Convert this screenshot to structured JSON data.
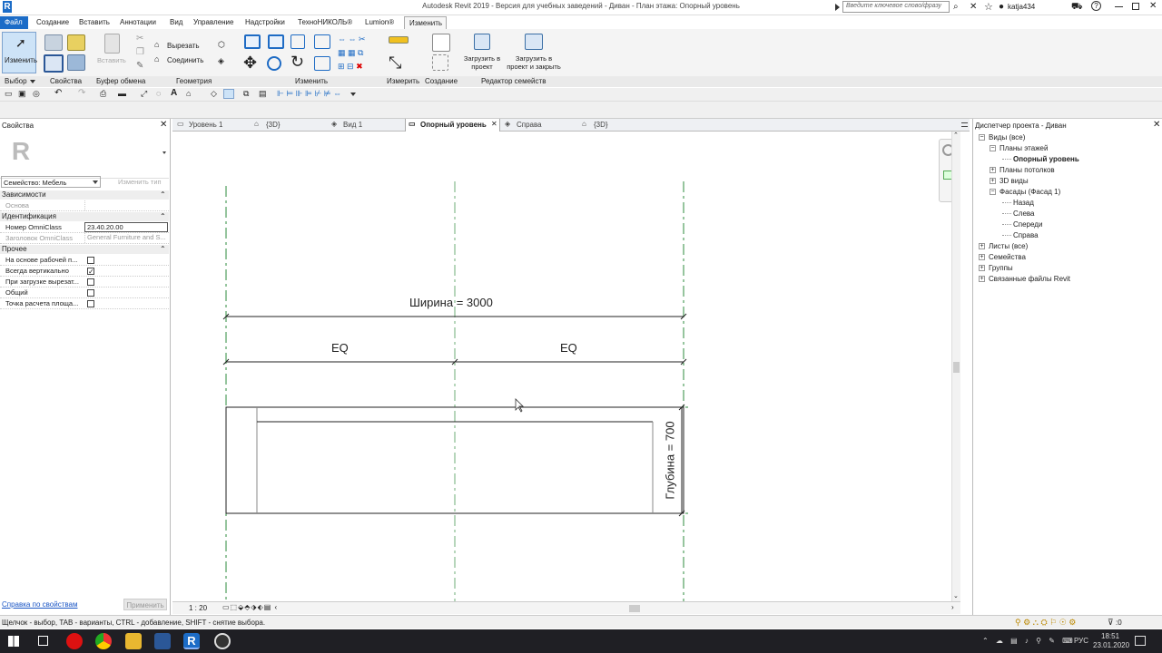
{
  "window": {
    "title": "Autodesk Revit 2019 - Версия для учебных заведений - Диван - План этажа: Опорный уровень"
  },
  "search": {
    "placeholder": "Введите ключевое слово/фразу"
  },
  "user": {
    "name": "katja434"
  },
  "menu": {
    "tabs": [
      "Файл",
      "Создание",
      "Вставить",
      "Аннотации",
      "Вид",
      "Управление",
      "Надстройки",
      "ТехноНИКОЛЬ®",
      "Lumion®",
      "Изменить"
    ],
    "active": "Изменить"
  },
  "ribbon": {
    "modify_label": "Изменить",
    "cut_label": "Вырезать",
    "join_label": "Соединить",
    "paste_label": "Вставить",
    "load_label": "Загрузить в проект",
    "load_close_label": "Загрузить в проект и закрыть",
    "panels": [
      "Выбор",
      "Свойства",
      "Буфер обмена",
      "Геометрия",
      "Изменить",
      "Измерить",
      "Создание",
      "Редактор семейств"
    ]
  },
  "properties": {
    "title": "Свойства",
    "family_selector": "Семейство: Мебель",
    "edit_type_label": "Изменить тип",
    "groups": {
      "constraints": {
        "label": "Зависимости",
        "rows": [
          {
            "key": "Основа",
            "value": ""
          }
        ]
      },
      "identity": {
        "label": "Идентификация",
        "rows": [
          {
            "key": "Номер OmniClass",
            "value": "23.40.20.00"
          },
          {
            "key": "Заголовок OmniClass",
            "value": "General Furniture and S..."
          }
        ]
      },
      "other": {
        "label": "Прочее",
        "rows": [
          {
            "key": "На основе рабочей п...",
            "checked": false
          },
          {
            "key": "Всегда вертикально",
            "checked": true
          },
          {
            "key": "При загрузке вырезат...",
            "checked": false
          },
          {
            "key": "Общий",
            "checked": false
          },
          {
            "key": "Точка расчета площа...",
            "checked": false
          }
        ]
      }
    },
    "help_link": "Справка по свойствам",
    "apply_label": "Применить"
  },
  "view_tabs": [
    {
      "label": "Уровень 1"
    },
    {
      "label": "{3D}"
    },
    {
      "label": "Вид 1"
    },
    {
      "label": "Опорный уровень",
      "active": true
    },
    {
      "label": "Справа"
    },
    {
      "label": "{3D}"
    }
  ],
  "drawing": {
    "width_label": "Ширина = 3000",
    "eq_left": "EQ",
    "eq_right": "EQ",
    "depth_label": "Глубина = 700"
  },
  "view_control": {
    "scale": "1 : 20"
  },
  "project_browser": {
    "title": "Диспетчер проекта - Диван",
    "tree": [
      {
        "label": "Виды (все)",
        "level": 0,
        "expanded": true
      },
      {
        "label": "Планы этажей",
        "level": 1,
        "expanded": true
      },
      {
        "label": "Опорный уровень",
        "level": 2,
        "bold": true
      },
      {
        "label": "Планы потолков",
        "level": 1
      },
      {
        "label": "3D виды",
        "level": 1
      },
      {
        "label": "Фасады (Фасад 1)",
        "level": 1,
        "expanded": true
      },
      {
        "label": "Назад",
        "level": 2
      },
      {
        "label": "Слева",
        "level": 2
      },
      {
        "label": "Спереди",
        "level": 2
      },
      {
        "label": "Справа",
        "level": 2
      },
      {
        "label": "Листы (все)",
        "level": 0
      },
      {
        "label": "Семейства",
        "level": 0
      },
      {
        "label": "Группы",
        "level": 0
      },
      {
        "label": "Связанные файлы Revit",
        "level": 0
      }
    ]
  },
  "status": {
    "hint": "Щелчок - выбор, TAB - варианты, CTRL - добавление, SHIFT - снятие выбора.",
    "filter_count": ":0"
  },
  "taskbar": {
    "lang": "РУС",
    "time": "18:51",
    "date": "23.01.2020"
  },
  "colors": {
    "file_tab": "#1c6cc7",
    "ref_plane": "#2e8b3e",
    "family_editor": "#c9c3ee"
  }
}
